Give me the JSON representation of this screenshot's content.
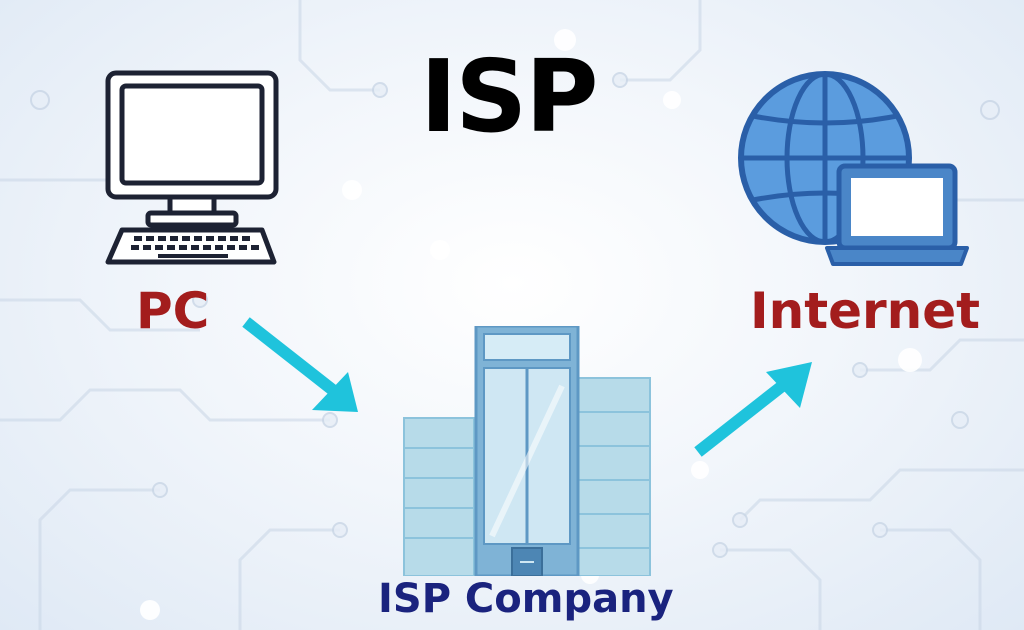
{
  "title": "ISP",
  "nodes": {
    "pc": {
      "label": "PC"
    },
    "internet": {
      "label": "Internet"
    },
    "isp_company": {
      "label": "ISP Company"
    }
  },
  "colors": {
    "node_label": "#a31d1d",
    "company_label": "#1a237e",
    "arrow": "#1fc3dc",
    "icon_outline": "#1d2233",
    "globe_fill": "#5b9cde",
    "globe_stroke": "#2a5fa8",
    "building_main": "#7fb3d6",
    "building_side": "#b7dbe9"
  },
  "edges": [
    {
      "from": "PC",
      "to": "ISP Company"
    },
    {
      "from": "ISP Company",
      "to": "Internet"
    }
  ]
}
